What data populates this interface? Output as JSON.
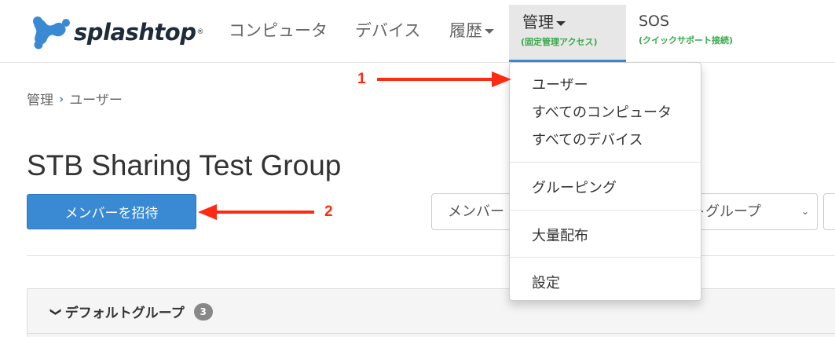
{
  "brand": {
    "logo_text": "splashtop",
    "logo_mark": "®",
    "colors": {
      "primary": "#3a8ad3",
      "accent_green": "#3aa94a",
      "annotation_red": "#ff2a12"
    }
  },
  "nav": {
    "computers": "コンピュータ",
    "devices": "デバイス",
    "history": "履歴",
    "admin": {
      "label": "管理",
      "sub": "(固定管理アクセス)"
    },
    "sos": {
      "label": "SOS",
      "sub": "(クイックサポート接続)"
    }
  },
  "breadcrumb": {
    "parent": "管理",
    "separator": "›",
    "current": "ユーザー"
  },
  "page_title": "STB Sharing Test Group",
  "invite_button": "メンバーを招待",
  "filters": {
    "members_select": "メンバー",
    "group_select": "デフォルトグループ",
    "chevron": "⌄"
  },
  "group": {
    "name": "デフォルトグループ",
    "count": "3",
    "chevron": "❯"
  },
  "dropdown": {
    "items": [
      "ユーザー",
      "すべてのコンピュータ",
      "すべてのデバイス",
      "グルーピング",
      "大量配布",
      "設定"
    ]
  },
  "annotations": {
    "one": "1",
    "two": "2"
  }
}
